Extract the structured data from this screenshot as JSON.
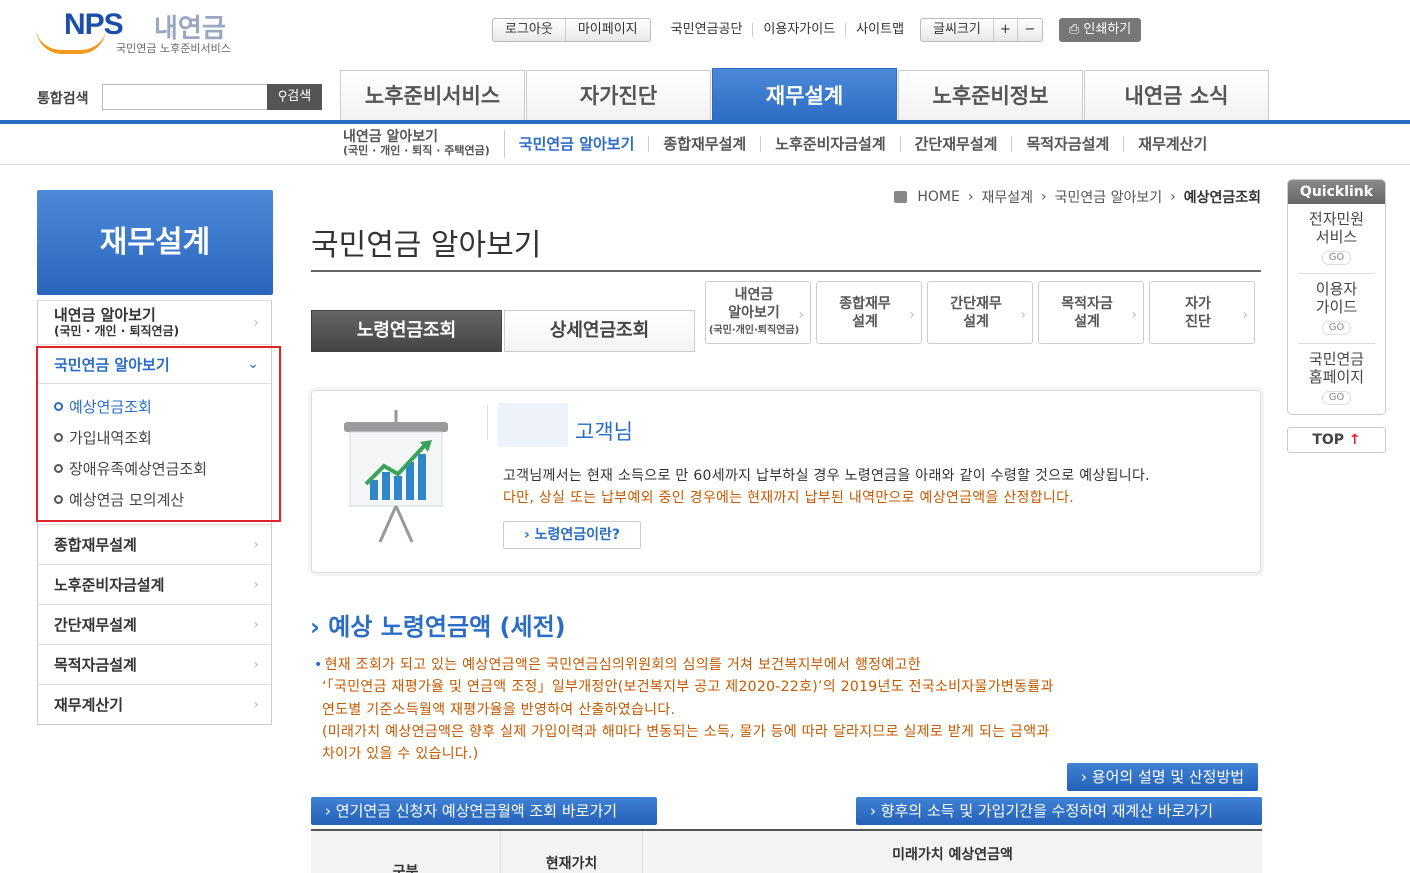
{
  "header": {
    "logo_nps": "NPS",
    "logo_kr": "내연금",
    "logo_sub": "국민연금 노후준비서비스",
    "util_buttons": [
      "로그아웃",
      "마이페이지"
    ],
    "util_links": [
      "국민연금공단",
      "이용자가이드",
      "사이트맵"
    ],
    "font_size_label": "글씨크기",
    "font_plus": "+",
    "font_minus": "−",
    "print_label": "인쇄하기",
    "search_label": "통합검색",
    "search_value": "",
    "search_button": "검색"
  },
  "gnb": [
    "노후준비서비스",
    "자가진단",
    "재무설계",
    "노후준비정보",
    "내연금 소식"
  ],
  "gnb_active": "재무설계",
  "sub_nav": {
    "first_line1": "내연금 알아보기",
    "first_line2": "(국민 · 개인 · 퇴직 · 주택연금)",
    "items": [
      "국민연금 알아보기",
      "종합재무설계",
      "노후준비자금설계",
      "간단재무설계",
      "목적자금설계",
      "재무계산기"
    ]
  },
  "lnb": {
    "title": "재무설계",
    "item1_line1": "내연금 알아보기",
    "item1_line2": "(국민 · 개인 · 퇴직연금)",
    "open_item": "국민연금 알아보기",
    "sub_items": [
      "예상연금조회",
      "가입내역조회",
      "장애유족예상연금조회",
      "예상연금 모의계산"
    ],
    "items": [
      "종합재무설계",
      "노후준비자금설계",
      "간단재무설계",
      "목적자금설계",
      "재무계산기"
    ]
  },
  "breadcrumb": {
    "home": "HOME",
    "path1": "재무설계",
    "path2": "국민연금 알아보기",
    "current": "예상연금조회"
  },
  "page_title": "국민연금 알아보기",
  "content_tabs": [
    "노령연금조회",
    "상세연금조회"
  ],
  "quick_buttons": [
    {
      "l1": "내연금",
      "l2": "알아보기",
      "l3": "(국민·개인·퇴직연금)"
    },
    {
      "l1": "종합재무",
      "l2": "설계",
      "l3": ""
    },
    {
      "l1": "간단재무",
      "l2": "설계",
      "l3": ""
    },
    {
      "l1": "목적자금",
      "l2": "설계",
      "l3": ""
    },
    {
      "l1": "자가",
      "l2": "진단",
      "l3": ""
    }
  ],
  "info": {
    "customer_suffix": "고객님",
    "line1": "고객님께서는 현재 소득으로 만 60세까지 납부하실 경우 노령연금을 아래와 같이 수령할 것으로 예상됩니다.",
    "line2": "다만, 상실 또는 납부예외 중인 경우에는 현재까지 납부된 내역만으로 예상연금액을 산정합니다.",
    "button": "노령연금이란?"
  },
  "section_title": "예상 노령연금액 (세전)",
  "notice": {
    "l1": "현재 조회가 되고 있는 예상연금액은 국민연금심의위원회의 심의를 거쳐 보건복지부에서 행정예고한",
    "l2": "‘「국민연금 재평가율 및 연금액 조정」일부개정안(보건복지부 공고 제2020-22호)’의 2019년도 전국소비자물가변동률과",
    "l3": "연도별 기준소득월액 재평가율을 반영하여 산출하였습니다.",
    "l4": "(미래가치 예상연금액은 향후 실제 가입이력과 해마다 변동되는 소득, 물가 등에 따라 달라지므로 실제로 받게 되는 금액과",
    "l5": "차이가 있을 수 있습니다.)"
  },
  "buttons": {
    "terms": "용어의 설명 및 산정방법",
    "delay": "연기연금 신청자 예상연금월액 조회 바로가기",
    "recalc": "향후의 소득 및 가입기간을 수정하여 재계산 바로가기"
  },
  "table_headers": {
    "col1": "구분",
    "col2": "현재가치",
    "col3": "미래가치 예상연금액"
  },
  "quicklink": {
    "title": "Quicklink",
    "items": [
      {
        "l1": "전자민원",
        "l2": "서비스"
      },
      {
        "l1": "이용자",
        "l2": "가이드"
      },
      {
        "l1": "국민연금",
        "l2": "홈페이지"
      }
    ],
    "go": "GO",
    "top": "TOP"
  },
  "colors": {
    "accent": "#2b6cc4",
    "highlight_border": "#e0242a",
    "notice": "#c45a00"
  }
}
